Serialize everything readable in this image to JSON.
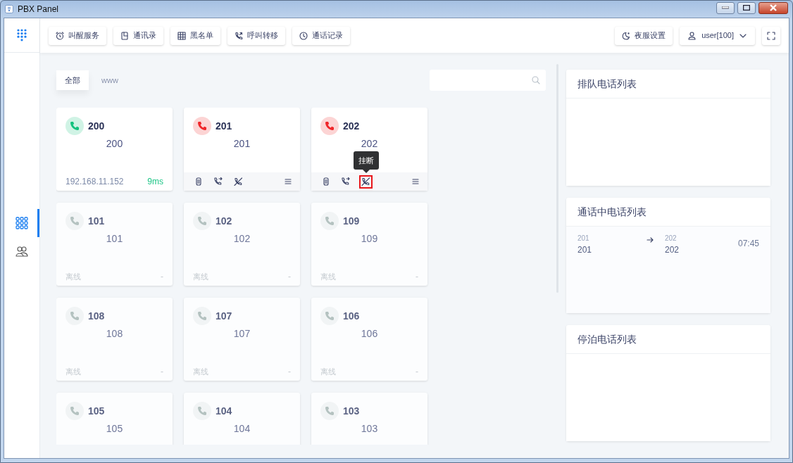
{
  "window": {
    "title": "PBX Panel"
  },
  "toolbar": {
    "buttons": [
      "叫醒服务",
      "通讯录",
      "黑名单",
      "呼叫转移",
      "通话记录"
    ],
    "night_mode": "夜服设置",
    "user": "user[100]"
  },
  "sidebar": {
    "items": [
      {
        "selected": true
      },
      {
        "selected": false
      }
    ]
  },
  "filter_tabs": [
    {
      "label": "全部",
      "selected": true
    },
    {
      "label": "www",
      "selected": false
    }
  ],
  "extensions": [
    {
      "number": "200",
      "name": "200",
      "kind": "online",
      "color": "#14c27f",
      "ip": "192.168.11.152",
      "latency": "9ms"
    },
    {
      "number": "201",
      "name": "201",
      "kind": "busy",
      "color": "#f0262a",
      "actions": [
        {
          "highlighted": false
        },
        {
          "highlighted": false
        },
        {
          "highlighted": false
        }
      ]
    },
    {
      "number": "202",
      "name": "202",
      "kind": "busy",
      "color": "#f0262a",
      "actions": [
        {
          "highlighted": false
        },
        {
          "highlighted": false
        },
        {
          "highlighted": true,
          "tooltip": "挂断"
        }
      ]
    },
    {
      "number": "101",
      "name": "101",
      "kind": "offline",
      "color": "#b4c2c0",
      "state": "离线",
      "latency": "-"
    },
    {
      "number": "102",
      "name": "102",
      "kind": "offline",
      "color": "#b4c2c0",
      "state": "离线",
      "latency": "-"
    },
    {
      "number": "109",
      "name": "109",
      "kind": "offline",
      "color": "#b4c2c0",
      "state": "离线",
      "latency": "-"
    },
    {
      "number": "108",
      "name": "108",
      "kind": "offline",
      "color": "#b4c2c0",
      "state": "离线",
      "latency": "-"
    },
    {
      "number": "107",
      "name": "107",
      "kind": "offline",
      "color": "#b4c2c0",
      "state": "离线",
      "latency": "-"
    },
    {
      "number": "106",
      "name": "106",
      "kind": "offline",
      "color": "#b4c2c0",
      "state": "离线",
      "latency": "-"
    },
    {
      "number": "105",
      "name": "105",
      "kind": "offline",
      "color": "#b4c2c0"
    },
    {
      "number": "104",
      "name": "104",
      "kind": "offline",
      "color": "#b4c2c0"
    },
    {
      "number": "103",
      "name": "103",
      "kind": "offline",
      "color": "#b4c2c0"
    }
  ],
  "panels": [
    {
      "title": "排队电话列表"
    },
    {
      "title": "通话中电话列表",
      "calls": [
        {
          "from_label": "201",
          "from": "201",
          "to_label": "202",
          "to": "202",
          "duration": "07:45"
        }
      ]
    },
    {
      "title": "停泊电话列表"
    }
  ]
}
